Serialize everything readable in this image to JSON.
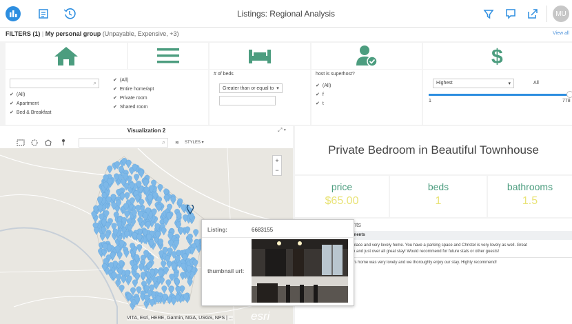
{
  "header": {
    "title": "Listings: Regional Analysis",
    "avatar_initials": "MU",
    "left_icons": [
      "dashboard-icon",
      "list-icon",
      "history-icon"
    ],
    "right_icons": [
      "filter-icon",
      "comment-icon",
      "share-icon"
    ]
  },
  "filterbar": {
    "label": "FILTERS (1)",
    "group": "My personal group",
    "group_detail": "(Unpayable, Expensive, +3)",
    "view_all": "View all"
  },
  "filters": {
    "home_options": [
      "(All)",
      "Apartment",
      "Bed & Breakfast"
    ],
    "room_options": [
      "(All)",
      "Entire home/apt",
      "Private room",
      "Shared room"
    ],
    "beds_label": "# of beds",
    "beds_select": "Greater than or equal to",
    "superhost_label": "host is superhost?",
    "superhost_options": [
      "(All)",
      "f",
      "t"
    ],
    "price_select": "Highest",
    "price_all": "All",
    "slider_min": "1",
    "slider_max": "778",
    "slider_value": 1.0
  },
  "visualization": {
    "title": "Visualization 2",
    "styles_label": "STYLES",
    "attribution": "VITA, Esri, HERE, Garmin, NGA, USGS, NPS | ...",
    "esri_logo": "esri"
  },
  "popup": {
    "listing_label": "Listing:",
    "listing_value": "6683155",
    "thumbnail_label": "thumbnail url:"
  },
  "detail": {
    "title": "Private Bedroom in Beautiful Townhouse",
    "price_label": "price",
    "price_value": "$65.00",
    "beds_label": "beds",
    "beds_value": "1",
    "bathrooms_label": "bathrooms",
    "bathrooms_value": "1.5"
  },
  "comments": {
    "title_fragment": "nts",
    "header_fragment": "ments",
    "row1": "place and very lovely home. You have a parking space and Christel is very lovely as well. Great",
    "row2": "n and just over all great stay! Would recommend for future stats or other guests!",
    "row3": "l's home was very lovely and we thoroughly enjoy our stay. Highly recommend!"
  },
  "colors": {
    "accent": "#2d8ee0",
    "teal": "#4c9d7f",
    "value_yellow": "#e9e377",
    "map_pin": "#7db8e8"
  }
}
